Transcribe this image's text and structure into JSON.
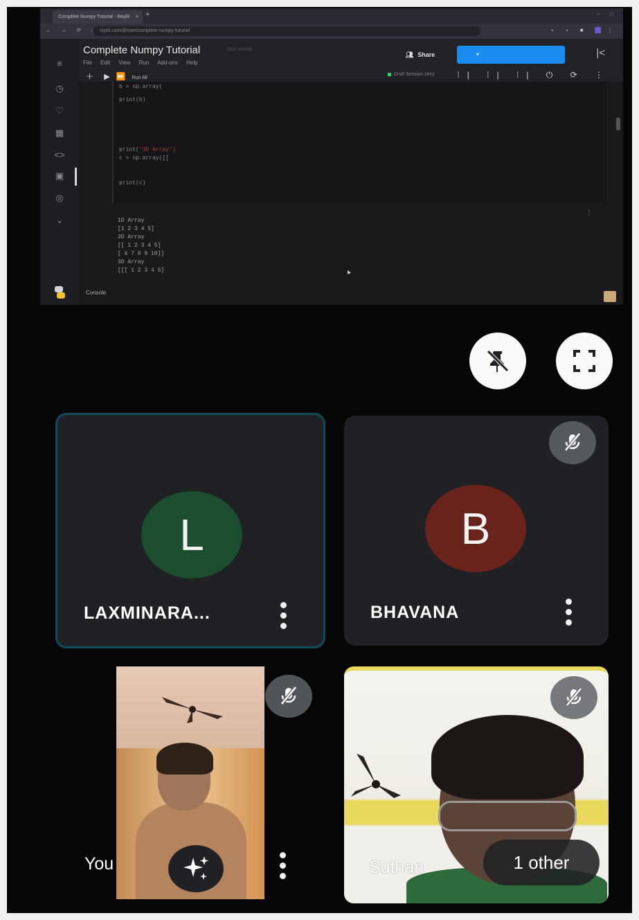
{
  "browser": {
    "tab_title": "Complete Numpy Tutorial - Replit",
    "tab_close": "×",
    "new_tab": "+",
    "window_controls": "– □",
    "nav": "← → ⟳ ⌂",
    "url": "replit.com/@user/complete-numpy-tutorial"
  },
  "ide": {
    "title": "Complete Numpy Tutorial",
    "status": "(last saved)",
    "menu": [
      "File",
      "Edit",
      "View",
      "Run",
      "Add-ons",
      "Help"
    ],
    "share_label": "Share",
    "run_all_label": "Run All",
    "session_text": "Draft Session (4m)",
    "console_label": "Console",
    "code_lines": [
      {
        "text": "b = np.array(",
        "red": ""
      },
      {
        "text": "print(b)",
        "red": ""
      },
      {
        "text": "print(",
        "red": "'3D Array')"
      },
      {
        "text": "c = np.array([[",
        "red": ""
      },
      {
        "text": "print(c)",
        "red": ""
      }
    ],
    "output_lines": [
      "1D Array",
      "[1 2 3 4 5]",
      "2D Array",
      "[[ 1  2  3  4  5]",
      " [ 6  7  8  9 10]]",
      "3D Array",
      "[[[ 1  2  3  4  5]"
    ]
  },
  "controls": {
    "pin_icon": "unpin-icon",
    "fullscreen_icon": "fullscreen-icon"
  },
  "participants": [
    {
      "initial": "L",
      "name": "LAXMINARA...",
      "avatar_color": "#1b4d2e",
      "muted": false
    },
    {
      "initial": "B",
      "name": "BHAVANA",
      "avatar_color": "#6a231b",
      "muted": true
    },
    {
      "name": "You",
      "muted": true,
      "effects_icon": "sparkle-icon"
    },
    {
      "name": "Suthan",
      "muted": true
    }
  ],
  "others_chip": "1 other",
  "colors": {
    "accent_blue": "#1a8cf0",
    "active_tile_border": "#0e4c5d",
    "tile_bg": "#202124"
  }
}
